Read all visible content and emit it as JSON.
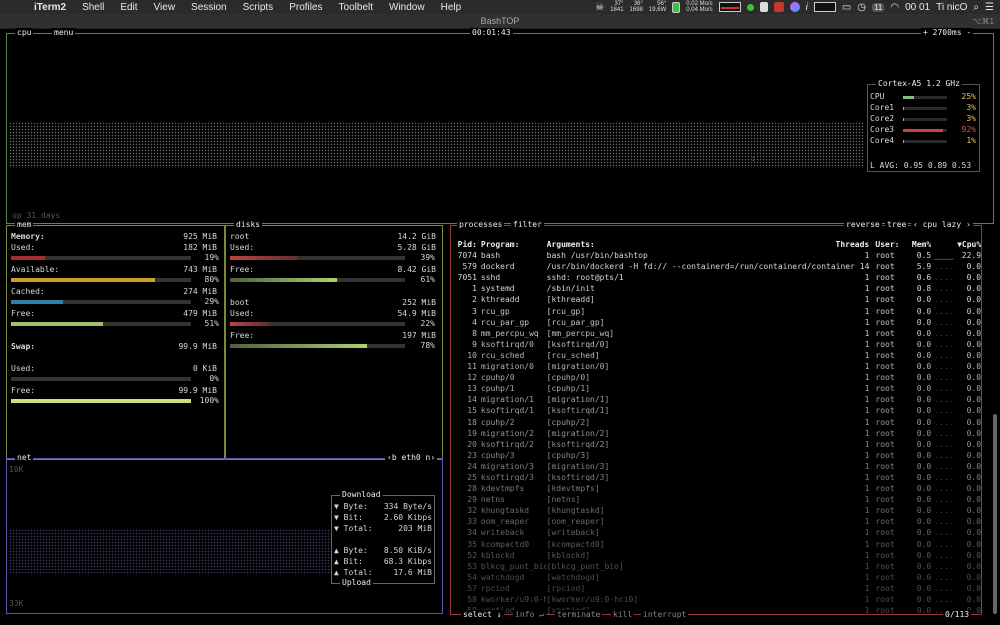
{
  "menubar": {
    "items": [
      "iTerm2",
      "Shell",
      "Edit",
      "View",
      "Session",
      "Scripts",
      "Profiles",
      "Toolbelt",
      "Window",
      "Help"
    ],
    "temp1": "37°",
    "temp1b": "1841",
    "temp2": "36°",
    "temp2b": "1698",
    "temp3": "56°",
    "temp3b": "19,6W",
    "net_up": "0,02 Mo/s",
    "net_down": "0,04 Mo/s",
    "badge": "11",
    "clock": "00 01",
    "user": "Ti nicO"
  },
  "window": {
    "title": "BashTOP",
    "shortcut": "⌥⌘1"
  },
  "cpu": {
    "tab_cpu": "cpu",
    "tab_menu": "menu",
    "clock": "00:01:43",
    "refresh": "+ 2700ms -",
    "uptime": "up 31 days",
    "model": "Cortex-A5",
    "freq": "1.2 GHz",
    "cores": [
      {
        "name": "CPU",
        "pct": "25%",
        "value": 25
      },
      {
        "name": "Core1",
        "pct": "3%",
        "value": 3
      },
      {
        "name": "Core2",
        "pct": "3%",
        "value": 3
      },
      {
        "name": "Core3",
        "pct": "92%",
        "value": 92
      },
      {
        "name": "Core4",
        "pct": "1%",
        "value": 1
      }
    ],
    "load_label": "L AVG:",
    "load": "0.95 0.89 0.53"
  },
  "mem": {
    "tag": "mem",
    "items": [
      {
        "label": "Memory:",
        "value": "925 MiB",
        "pct": ""
      },
      {
        "label": "Used:",
        "value": "182 MiB",
        "pct": "19%",
        "level": 19,
        "color": "#a03030"
      },
      {
        "label": "Available:",
        "value": "743 MiB",
        "pct": "80%",
        "level": 80,
        "color": "#c8a030"
      },
      {
        "label": "Cached:",
        "value": "274 MiB",
        "pct": "29%",
        "level": 29,
        "color": "#3080a8"
      },
      {
        "label": "Free:",
        "value": "479 MiB",
        "pct": "51%",
        "level": 51,
        "color": "#a0c070"
      },
      {
        "label": "Swap:",
        "value": "99.9 MiB",
        "pct": ""
      },
      {
        "label": "Used:",
        "value": "0 KiB",
        "pct": "0%",
        "level": 0,
        "color": "#a03030"
      },
      {
        "label": "Free:",
        "value": "99.9 MiB",
        "pct": "100%",
        "level": 100,
        "color": "#c8e080"
      }
    ]
  },
  "disks": {
    "tag": "disks",
    "root": {
      "name": "root",
      "size": "14.2 GiB",
      "used_label": "Used:",
      "used": "5.28 GiB",
      "used_pct": "39%",
      "used_level": 39,
      "free_label": "Free:",
      "free": "8.42 GiB",
      "free_pct": "61%",
      "free_level": 61
    },
    "boot": {
      "name": "boot",
      "size": "252 MiB",
      "used_label": "Used:",
      "used": "54.9 MiB",
      "used_pct": "22%",
      "used_level": 22,
      "free_label": "Free:",
      "free": "197 MiB",
      "free_pct": "78%",
      "free_level": 78
    }
  },
  "net": {
    "tag": "net",
    "iface": "‹b eth0 n›",
    "scale_top": "10K",
    "scale_bottom": "33K",
    "download_label": "Download",
    "upload_label": "Upload",
    "down": [
      {
        "label": "▼ Byte:",
        "value": "334 Byte/s"
      },
      {
        "label": "▼ Bit:",
        "value": "2.60 Kibps"
      },
      {
        "label": "▼ Total:",
        "value": "203 MiB"
      }
    ],
    "up": [
      {
        "label": "▲ Byte:",
        "value": "8.50 KiB/s"
      },
      {
        "label": "▲ Bit:",
        "value": "68.3 Kibps"
      },
      {
        "label": "▲ Total:",
        "value": "17.6 MiB"
      }
    ]
  },
  "proc": {
    "tab_processes": "processes",
    "tab_filter": "filter",
    "tab_reverse": "reverse",
    "tab_tree": "tree",
    "tab_sort": "‹ cpu lazy ›",
    "headers": {
      "pid": "Pid:",
      "prog": "Program:",
      "args": "Arguments:",
      "thr": "Threads:",
      "user": "User:",
      "mem": "Mem%",
      "cpu": "▼Cpu%"
    },
    "rows": [
      [
        "7074",
        "bash",
        "bash /usr/bin/bashtop",
        "1",
        "root",
        "0.5",
        "22.9"
      ],
      [
        "579",
        "dockerd",
        "/usr/bin/dockerd -H fd:// --containerd=/run/containerd/containerd.",
        "14",
        "root",
        "5.9",
        "0.0"
      ],
      [
        "7051",
        "sshd",
        "sshd: root@pts/1",
        "1",
        "root",
        "0.6",
        "0.0"
      ],
      [
        "1",
        "systemd",
        "/sbin/init",
        "1",
        "root",
        "0.8",
        "0.0"
      ],
      [
        "2",
        "kthreadd",
        "[kthreadd]",
        "1",
        "root",
        "0.0",
        "0.0"
      ],
      [
        "3",
        "rcu_gp",
        "[rcu_gp]",
        "1",
        "root",
        "0.0",
        "0.0"
      ],
      [
        "4",
        "rcu_par_gp",
        "[rcu_par_gp]",
        "1",
        "root",
        "0.0",
        "0.0"
      ],
      [
        "8",
        "mm_percpu_wq",
        "[mm_percpu_wq]",
        "1",
        "root",
        "0.0",
        "0.0"
      ],
      [
        "9",
        "ksoftirqd/0",
        "[ksoftirqd/0]",
        "1",
        "root",
        "0.0",
        "0.0"
      ],
      [
        "10",
        "rcu_sched",
        "[rcu_sched]",
        "1",
        "root",
        "0.0",
        "0.0"
      ],
      [
        "11",
        "migration/0",
        "[migration/0]",
        "1",
        "root",
        "0.0",
        "0.0"
      ],
      [
        "12",
        "cpuhp/0",
        "[cpuhp/0]",
        "1",
        "root",
        "0.0",
        "0.0"
      ],
      [
        "13",
        "cpuhp/1",
        "[cpuhp/1]",
        "1",
        "root",
        "0.0",
        "0.0"
      ],
      [
        "14",
        "migration/1",
        "[migration/1]",
        "1",
        "root",
        "0.0",
        "0.0"
      ],
      [
        "15",
        "ksoftirqd/1",
        "[ksoftirqd/1]",
        "1",
        "root",
        "0.0",
        "0.0"
      ],
      [
        "18",
        "cpuhp/2",
        "[cpuhp/2]",
        "1",
        "root",
        "0.0",
        "0.0"
      ],
      [
        "19",
        "migration/2",
        "[migration/2]",
        "1",
        "root",
        "0.0",
        "0.0"
      ],
      [
        "20",
        "ksoftirqd/2",
        "[ksoftirqd/2]",
        "1",
        "root",
        "0.0",
        "0.0"
      ],
      [
        "23",
        "cpuhp/3",
        "[cpuhp/3]",
        "1",
        "root",
        "0.0",
        "0.0"
      ],
      [
        "24",
        "migration/3",
        "[migration/3]",
        "1",
        "root",
        "0.0",
        "0.0"
      ],
      [
        "25",
        "ksoftirqd/3",
        "[ksoftirqd/3]",
        "1",
        "root",
        "0.0",
        "0.0"
      ],
      [
        "28",
        "kdevtmpfs",
        "[kdevtmpfs]",
        "1",
        "root",
        "0.0",
        "0.0"
      ],
      [
        "29",
        "netns",
        "[netns]",
        "1",
        "root",
        "0.0",
        "0.0"
      ],
      [
        "32",
        "khungtaskd",
        "[khungtaskd]",
        "1",
        "root",
        "0.0",
        "0.0"
      ],
      [
        "33",
        "oom_reaper",
        "[oom_reaper]",
        "1",
        "root",
        "0.0",
        "0.0"
      ],
      [
        "34",
        "writeback",
        "[writeback]",
        "1",
        "root",
        "0.0",
        "0.0"
      ],
      [
        "35",
        "kcompactd0",
        "[kcompactd0]",
        "1",
        "root",
        "0.0",
        "0.0"
      ],
      [
        "52",
        "kblockd",
        "[kblockd]",
        "1",
        "root",
        "0.0",
        "0.0"
      ],
      [
        "53",
        "blkcg_punt_bio",
        "[blkcg_punt_bio]",
        "1",
        "root",
        "0.0",
        "0.0"
      ],
      [
        "54",
        "watchdogd",
        "[watchdogd]",
        "1",
        "root",
        "0.0",
        "0.0"
      ],
      [
        "57",
        "rpciod",
        "[rpciod]",
        "1",
        "root",
        "0.0",
        "0.0"
      ],
      [
        "58",
        "kworker/u9:0-hc",
        "[kworker/u9:0-hci0]",
        "1",
        "root",
        "0.0",
        "0.0"
      ],
      [
        "59",
        "xprtiod",
        "[xprtiod]",
        "1",
        "root",
        "0.0",
        "0.0"
      ]
    ],
    "footer": {
      "select": "select ↓",
      "info": "info ↵",
      "terminate": "terminate",
      "kill": "kill",
      "interrupt": "interrupt",
      "count": "0/113"
    }
  }
}
